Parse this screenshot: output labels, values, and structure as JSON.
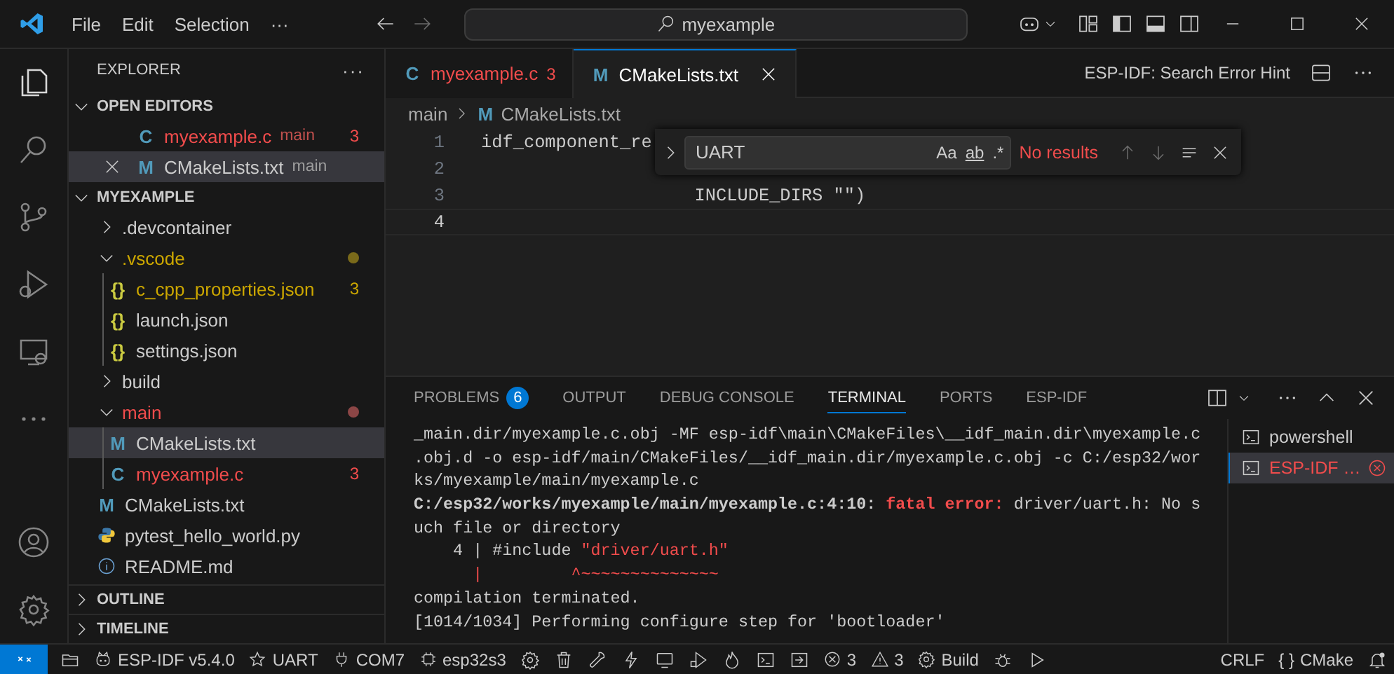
{
  "title_bar": {
    "menus": [
      "File",
      "Edit",
      "Selection",
      "···"
    ],
    "search": {
      "value": "myexample"
    }
  },
  "activity_bar": {
    "items": [
      {
        "kind": "files",
        "selected": true
      },
      {
        "kind": "search",
        "selected": false
      },
      {
        "kind": "scm",
        "selected": false
      },
      {
        "kind": "debug",
        "selected": false
      },
      {
        "kind": "remote",
        "selected": false
      },
      {
        "kind": "more",
        "selected": false
      }
    ],
    "bottom": [
      {
        "kind": "account"
      },
      {
        "kind": "gear"
      }
    ]
  },
  "sidebar": {
    "title": "EXPLORER",
    "more": "···",
    "open_editors": {
      "title": "OPEN EDITORS",
      "expanded": true,
      "items": [
        {
          "kind": "text_icon",
          "icon": "C",
          "color": "#519aba",
          "name": "myexample.c",
          "detail": "main",
          "badge": "3",
          "error": true,
          "warning": false,
          "selected": false
        },
        {
          "kind": "text_icon",
          "icon": "M",
          "color": "#519aba",
          "name": "CMakeLists.txt",
          "detail": "main",
          "error": false,
          "warning": false,
          "selected": true
        }
      ]
    },
    "folder": {
      "title": "MYEXAMPLE",
      "expanded": true,
      "items": [
        {
          "kind": "folder",
          "name": ".devcontainer",
          "expanded": false,
          "error": false,
          "warning": false,
          "selected": false
        },
        {
          "kind": "folder",
          "name": ".vscode",
          "expanded": true,
          "error": false,
          "warning": true,
          "selected": false,
          "children": [
            {
              "kind": "text_icon",
              "icon": "{}",
              "color": "#cbcb41",
              "name": "c_cpp_properties.json",
              "badge": "3",
              "error": false,
              "warning": true,
              "selected": false
            },
            {
              "kind": "text_icon",
              "icon": "{}",
              "color": "#cbcb41",
              "name": "launch.json",
              "error": false,
              "warning": false,
              "selected": false
            },
            {
              "kind": "text_icon",
              "icon": "{}",
              "color": "#cbcb41",
              "name": "settings.json",
              "error": false,
              "warning": false,
              "selected": false
            }
          ]
        },
        {
          "kind": "folder",
          "name": "build",
          "expanded": false,
          "error": false,
          "warning": false,
          "selected": false
        },
        {
          "kind": "folder",
          "name": "main",
          "expanded": true,
          "error": true,
          "warning": false,
          "selected": false,
          "children": [
            {
              "kind": "text_icon",
              "icon": "M",
              "color": "#519aba",
              "name": "CMakeLists.txt",
              "error": false,
              "warning": false,
              "selected": true
            },
            {
              "kind": "text_icon",
              "icon": "C",
              "color": "#519aba",
              "name": "myexample.c",
              "badge": "3",
              "error": true,
              "warning": false,
              "selected": false
            }
          ]
        },
        {
          "kind": "text_icon",
          "icon": "M",
          "color": "#519aba",
          "name": "CMakeLists.txt",
          "error": false,
          "warning": false,
          "selected": false
        },
        {
          "kind": "python",
          "name": "pytest_hello_world.py",
          "error": false,
          "warning": false,
          "selected": false
        },
        {
          "kind": "info",
          "name": "README.md",
          "error": false,
          "warning": false,
          "selected": false
        }
      ]
    },
    "sections": [
      {
        "title": "OUTLINE",
        "expanded": false
      },
      {
        "title": "TIMELINE",
        "expanded": false
      }
    ]
  },
  "editor": {
    "tabs": [
      {
        "icon": "C",
        "color": "#519aba",
        "label": "myexample.c",
        "badge": "3",
        "error": true,
        "selected": false
      },
      {
        "icon": "M",
        "color": "#519aba",
        "label": "CMakeLists.txt",
        "error": false,
        "selected": true
      }
    ],
    "action": "ESP-IDF: Search Error Hint",
    "breadcrumb": [
      {
        "label": "main"
      },
      {
        "icon": "M",
        "color": "#519aba",
        "label": "CMakeLists.txt"
      }
    ],
    "lines": [
      {
        "number": "1",
        "text": "idf_component_re",
        "current": false
      },
      {
        "number": "2",
        "current": false
      },
      {
        "number": "3",
        "text": "                    INCLUDE_DIRS \"\")",
        "current": false
      },
      {
        "number": "4",
        "current": true
      }
    ],
    "find": {
      "value": "UART",
      "options": [
        "Aa",
        "ab",
        ".*"
      ],
      "result": "No results"
    }
  },
  "panel": {
    "tabs": [
      {
        "label": "PROBLEMS",
        "badge": "6",
        "selected": false
      },
      {
        "label": "OUTPUT",
        "selected": false
      },
      {
        "label": "DEBUG CONSOLE",
        "selected": false
      },
      {
        "label": "TERMINAL",
        "selected": true
      },
      {
        "label": "PORTS",
        "selected": false
      },
      {
        "label": "ESP-IDF",
        "selected": false
      }
    ],
    "terminal": [
      [
        {
          "kind": "plain",
          "text": "_main.dir/myexample.c.obj -MF esp-idf\\main\\CMakeFiles\\__idf_main.dir\\myexample.c"
        }
      ],
      [
        {
          "kind": "plain",
          "text": ".obj.d -o esp-idf/main/CMakeFiles/__idf_main.dir/myexample.c.obj -c C:/esp32/wor"
        }
      ],
      [
        {
          "kind": "plain",
          "text": "ks/myexample/main/myexample.c"
        }
      ],
      [
        {
          "kind": "bold",
          "text": "C:/esp32/works/myexample/main/myexample.c:4:10: "
        },
        {
          "kind": "error",
          "text": "fatal error:"
        },
        {
          "kind": "plain",
          "text": " driver/uart.h: No s"
        }
      ],
      [
        {
          "kind": "plain",
          "text": "uch file or directory"
        }
      ],
      [
        {
          "kind": "plain",
          "text": "    4 | #include "
        },
        {
          "kind": "string",
          "text": "\"driver/uart.h\""
        }
      ],
      [
        {
          "kind": "string",
          "text": "      |         ^~~~~~~~~~~~~~~"
        }
      ],
      [
        {
          "kind": "plain",
          "text": "compilation terminated."
        }
      ],
      [
        {
          "kind": "plain",
          "text": "[1014/1034] Performing configure step for 'bootloader'"
        }
      ]
    ],
    "terminals": [
      {
        "name": "powershell",
        "error": false,
        "selected": false
      },
      {
        "name": "ESP-IDF …",
        "error": true,
        "selected": true
      }
    ]
  },
  "status_bar": {
    "left": [
      {
        "kind": "remote"
      },
      {
        "kind": "folders"
      },
      {
        "kind": "esp",
        "text": "ESP-IDF v5.4.0"
      },
      {
        "kind": "star",
        "text": "UART"
      },
      {
        "kind": "plug",
        "text": "COM7"
      },
      {
        "kind": "chip",
        "text": "esp32s3"
      },
      {
        "kind": "gear"
      },
      {
        "kind": "trash"
      },
      {
        "kind": "wrench"
      },
      {
        "kind": "bolt"
      },
      {
        "kind": "monitor"
      },
      {
        "kind": "flash"
      },
      {
        "kind": "flame"
      },
      {
        "kind": "terminal"
      },
      {
        "kind": "enter"
      },
      {
        "kind": "errors",
        "text": "3"
      },
      {
        "kind": "warnings",
        "text": "3"
      },
      {
        "kind": "gear",
        "text": "Build"
      },
      {
        "kind": "bug"
      },
      {
        "kind": "play"
      }
    ],
    "right": [
      {
        "kind": "plain",
        "text": "CRLF"
      },
      {
        "kind": "braces",
        "icon": "{ }",
        "text": "CMake"
      },
      {
        "kind": "bell"
      }
    ]
  }
}
